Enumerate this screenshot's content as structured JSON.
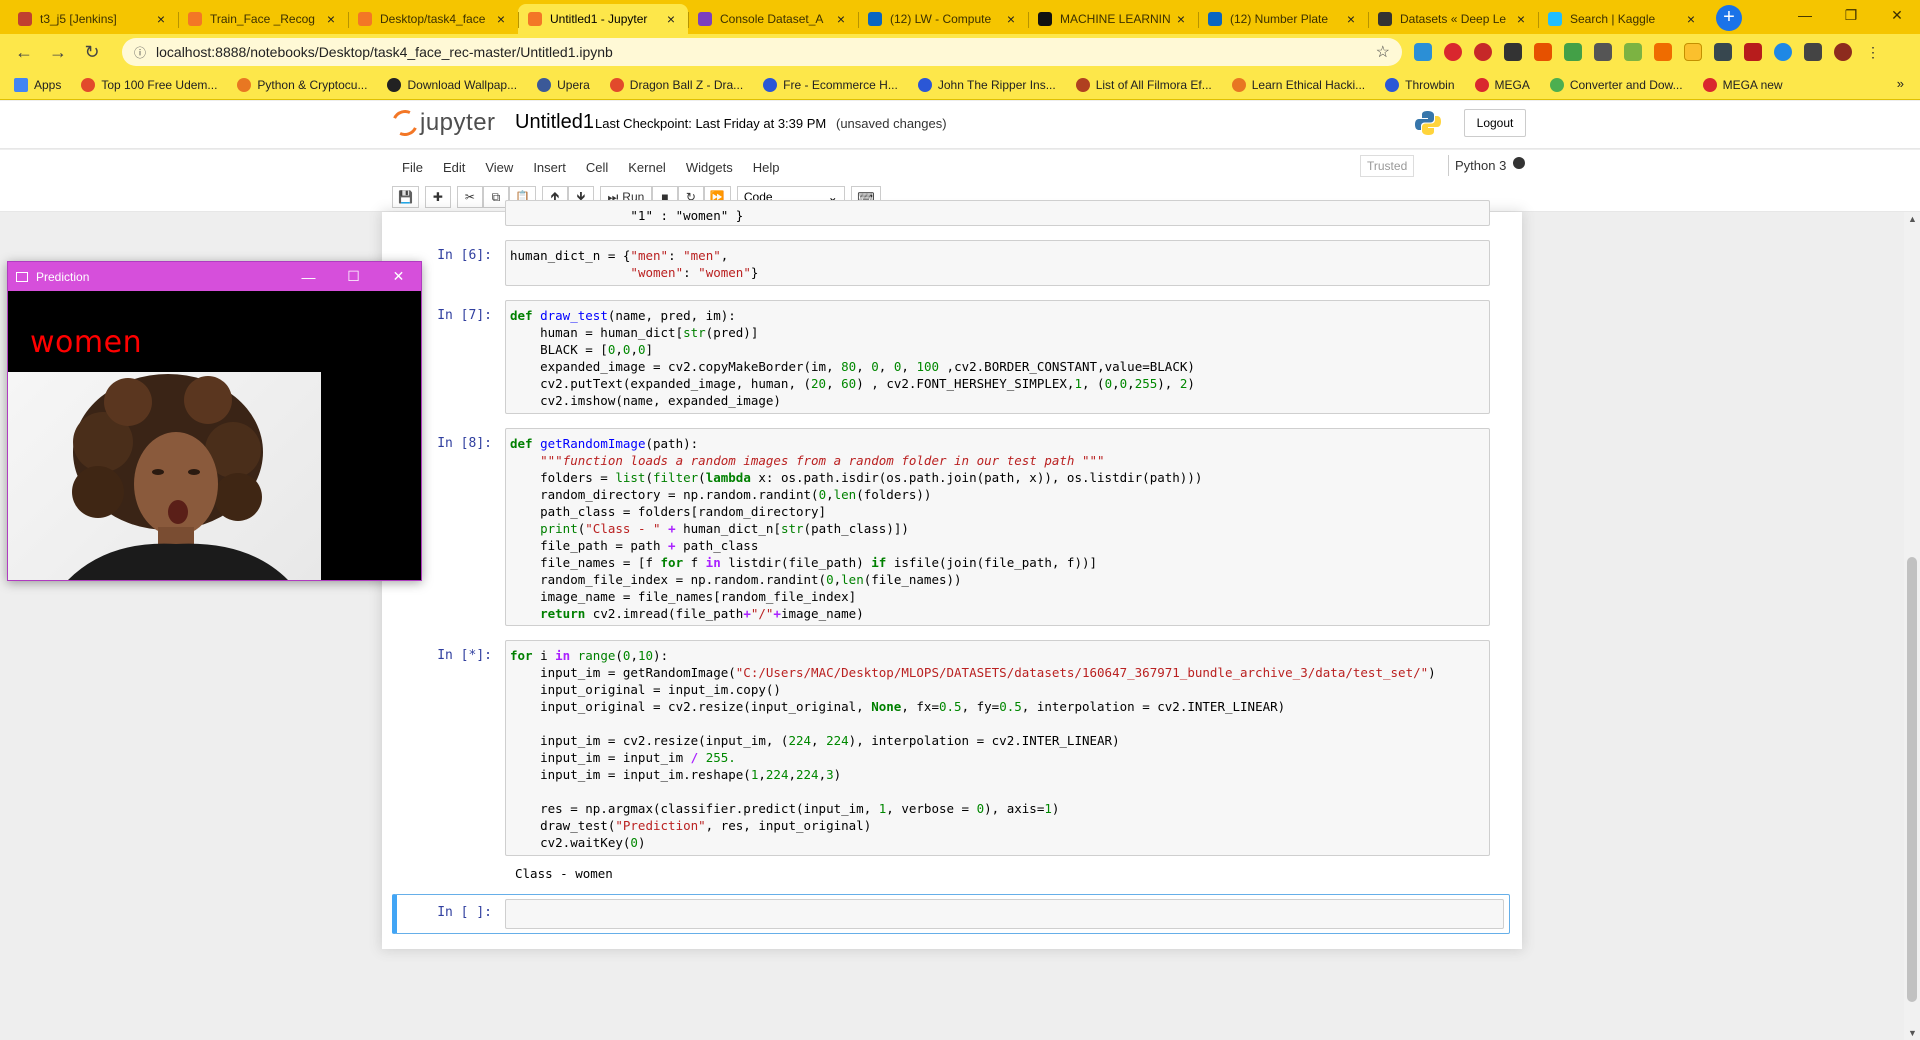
{
  "browser": {
    "tabs": [
      {
        "label": "t3_j5 [Jenkins]",
        "color": "#c04030",
        "active": false
      },
      {
        "label": "Train_Face _Recog",
        "color": "#f37726",
        "active": false
      },
      {
        "label": "Desktop/task4_face",
        "color": "#f37726",
        "active": false
      },
      {
        "label": "Untitled1 - Jupyter",
        "color": "#f37726",
        "active": true
      },
      {
        "label": "Console Dataset_A",
        "color": "#7b3fbf",
        "active": false
      },
      {
        "label": "(12) LW - Compute",
        "color": "#0a66c2",
        "active": false
      },
      {
        "label": "MACHINE LEARNIN",
        "color": "#111111",
        "active": false
      },
      {
        "label": "(12) Number Plate",
        "color": "#0a66c2",
        "active": false
      },
      {
        "label": "Datasets « Deep Le",
        "color": "#333333",
        "active": false
      },
      {
        "label": "Search | Kaggle",
        "color": "#20beff",
        "active": false
      }
    ],
    "new_tab": "+",
    "url": "localhost:8888/notebooks/Desktop/task4_face_rec-master/Untitled1.ipynb",
    "bookmarks": [
      {
        "label": "Apps",
        "color": "#4285f4"
      },
      {
        "label": "Top 100 Free Udem...",
        "color": "#e24a2b"
      },
      {
        "label": "Python & Cryptocu...",
        "color": "#e87722"
      },
      {
        "label": "Download Wallpap...",
        "color": "#222222"
      },
      {
        "label": "Upera",
        "color": "#3b5998"
      },
      {
        "label": "Dragon Ball Z - Dra...",
        "color": "#e24a2b"
      },
      {
        "label": "Fre - Ecommerce H...",
        "color": "#2b57d6"
      },
      {
        "label": "John The Ripper Ins...",
        "color": "#2b57d6"
      },
      {
        "label": "List of All Filmora Ef...",
        "color": "#b04020"
      },
      {
        "label": "Learn Ethical Hacki...",
        "color": "#e87722"
      },
      {
        "label": "Throwbin",
        "color": "#2b57d6"
      },
      {
        "label": "MEGA",
        "color": "#d9272e"
      },
      {
        "label": "Converter and Dow...",
        "color": "#4caf50"
      },
      {
        "label": "MEGA new",
        "color": "#d9272e"
      }
    ],
    "more_bookmarks": "»"
  },
  "jupyter": {
    "logo_text": "jupyter",
    "notebook_name": "Untitled1",
    "checkpoint": "Last Checkpoint: Last Friday at 3:39 PM",
    "unsaved": "(unsaved changes)",
    "logout": "Logout",
    "menu": [
      "File",
      "Edit",
      "View",
      "Insert",
      "Cell",
      "Kernel",
      "Widgets",
      "Help"
    ],
    "trusted": "Trusted",
    "kernel": "Python 3",
    "toolbar": {
      "run_label": "Run",
      "cell_type": "Code"
    }
  },
  "cells": {
    "c0_tail": "                \"1\" : \"women\" }",
    "c6_prompt": "In [6]:",
    "c7_prompt": "In [7]:",
    "c8_prompt": "In [8]:",
    "c9_prompt": "In [*]:",
    "c9_output": "Class - women",
    "c10_prompt": "In [ ]:"
  },
  "prediction_window": {
    "title": "Prediction",
    "label": "women",
    "label_color": "#ff0000"
  }
}
